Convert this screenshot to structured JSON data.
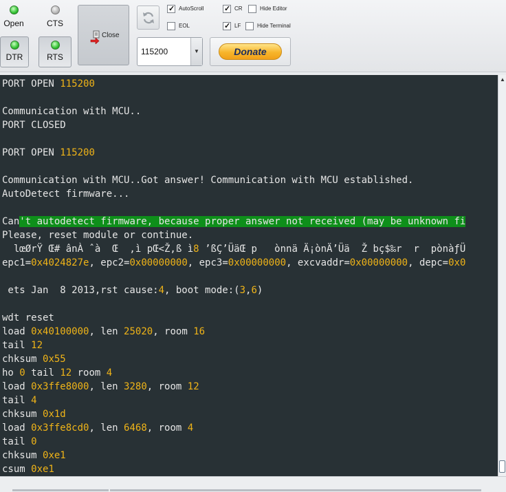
{
  "toolbar": {
    "signals": [
      {
        "label": "Open",
        "led": "green"
      },
      {
        "label": "CTS",
        "led": "gray"
      },
      {
        "label": "DTR",
        "led": "green"
      },
      {
        "label": "RTS",
        "led": "green"
      }
    ],
    "close_label": "Close",
    "checkboxes": [
      {
        "label": "AutoScroll",
        "checked": true
      },
      {
        "label": "EOL",
        "checked": false
      },
      {
        "label": "CR",
        "checked": true
      },
      {
        "label": "LF",
        "checked": true
      },
      {
        "label": "Hide Editor",
        "checked": false
      },
      {
        "label": "Hide Terminal",
        "checked": false
      }
    ],
    "baud_rate": "115200",
    "donate_label": "Donate"
  },
  "terminal": {
    "background": "#283135",
    "number_color": "#f0b418",
    "highlight_color": "#0e8f1a",
    "lines": [
      "PORT OPEN 115200",
      "",
      "Communication with MCU..",
      "PORT CLOSED",
      "",
      "PORT OPEN 115200",
      "",
      "Communication with MCU..Got answer! Communication with MCU established.",
      "AutoDetect firmware...",
      "",
      "Can't autodetect firmware, because proper answer not received (may be unknown fi",
      "Please, reset module or continue.",
      "  lœØrŸ Œ# ânÀ ˆà  Œ  ,ì pŒ<Ž,ß ì8 ’ßÇ’ÜäŒ p   ònnä Ä¡ònÄ’Üä  Ž bç$‰r  r  pònàƒÜ",
      "epc1=0x4024827e, epc2=0x00000000, epc3=0x00000000, excvaddr=0x00000000, depc=0x0",
      "",
      " ets Jan  8 2013,rst cause:4, boot mode:(3,6)",
      "",
      "wdt reset",
      "load 0x40100000, len 25020, room 16",
      "tail 12",
      "chksum 0x55",
      "ho 0 tail 12 room 4",
      "load 0x3ffe8000, len 3280, room 12",
      "tail 4",
      "chksum 0x1d",
      "load 0x3ffe8cd0, len 6468, room 4",
      "tail 0",
      "chksum 0xe1",
      "csum 0xe1"
    ]
  }
}
